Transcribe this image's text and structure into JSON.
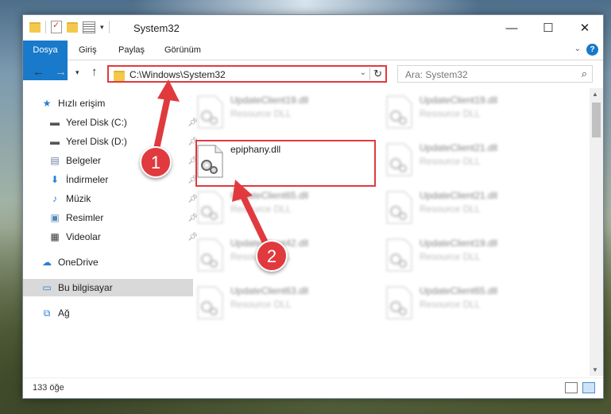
{
  "window": {
    "title": "System32",
    "controls": {
      "minimize": "—",
      "maximize": "☐",
      "close": "✕"
    }
  },
  "ribbon": {
    "tabs": [
      "Dosya",
      "Giriş",
      "Paylaş",
      "Görünüm"
    ],
    "help": "?"
  },
  "address": {
    "path": "C:\\Windows\\System32",
    "search_placeholder": "Ara: System32"
  },
  "sidebar": {
    "items": [
      {
        "label": "Hızlı erişim",
        "icon": "star-icon",
        "pinned": false
      },
      {
        "label": "Yerel Disk (C:)",
        "icon": "drive-icon",
        "pinned": true
      },
      {
        "label": "Yerel Disk (D:)",
        "icon": "drive-icon",
        "pinned": true
      },
      {
        "label": "Belgeler",
        "icon": "documents-icon",
        "pinned": true
      },
      {
        "label": "İndirmeler",
        "icon": "download-icon",
        "pinned": true
      },
      {
        "label": "Müzik",
        "icon": "music-icon",
        "pinned": true
      },
      {
        "label": "Resimler",
        "icon": "pictures-icon",
        "pinned": true
      },
      {
        "label": "Videolar",
        "icon": "videos-icon",
        "pinned": true
      },
      {
        "label": "OneDrive",
        "icon": "cloud-icon",
        "pinned": false
      },
      {
        "label": "Bu bilgisayar",
        "icon": "computer-icon",
        "pinned": false
      },
      {
        "label": "Ağ",
        "icon": "network-icon",
        "pinned": false
      }
    ]
  },
  "files": [
    {
      "name": "UpdateClient19.dll",
      "desc": "Resource DLL",
      "blurred": true
    },
    {
      "name": "UpdateClient19.dll",
      "desc": "Resource DLL",
      "blurred": true
    },
    {
      "name": "epiphany.dll",
      "desc": "",
      "blurred": false
    },
    {
      "name": "UpdateClient21.dll",
      "desc": "Resource DLL",
      "blurred": true
    },
    {
      "name": "UpdateClient65.dll",
      "desc": "Resource DLL",
      "blurred": true
    },
    {
      "name": "UpdateClient21.dll",
      "desc": "Resource DLL",
      "blurred": true
    },
    {
      "name": "UpdateClient42.dll",
      "desc": "Resource DLL",
      "blurred": true
    },
    {
      "name": "UpdateClient19.dll",
      "desc": "Resource DLL",
      "blurred": true
    },
    {
      "name": "UpdateClient63.dll",
      "desc": "Resource DLL",
      "blurred": true
    },
    {
      "name": "UpdateClient65.dll",
      "desc": "Resource DLL",
      "blurred": true
    }
  ],
  "status": {
    "count": "133 öğe"
  },
  "annotations": {
    "step1": "1",
    "step2": "2"
  },
  "colors": {
    "accent": "#1979ca",
    "annotation": "#e03a3e",
    "selected": "#d9d9d9"
  }
}
